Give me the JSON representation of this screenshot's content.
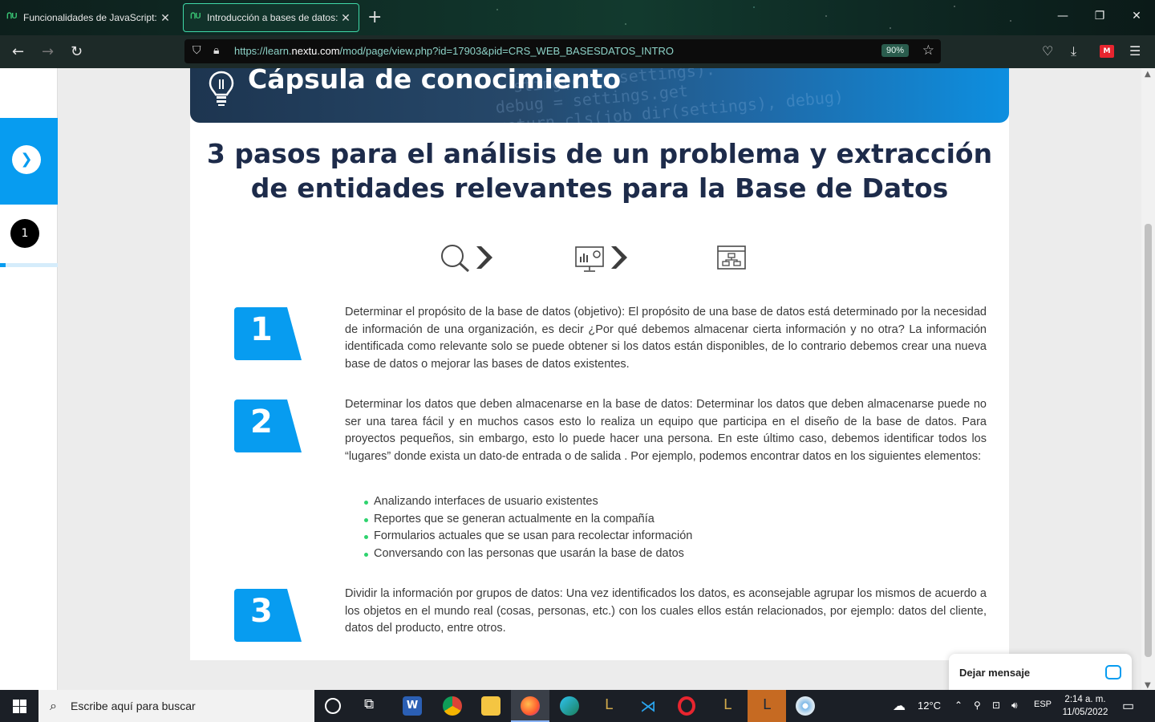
{
  "browser": {
    "tabs": [
      {
        "title": "Funcionalidades de JavaScript: F",
        "active": false
      },
      {
        "title": "Introducción a bases de datos: ",
        "active": true
      }
    ],
    "url_prefix": "https://learn.",
    "url_domain": "nextu.com",
    "url_rest": "/mod/page/view.php?id=17903&pid=CRS_WEB_BASESDATOS_INTRO",
    "zoom": "90%"
  },
  "page": {
    "banner_title": "Cápsula de conocimiento",
    "banner_code": "  sting(cls, settings).\ndebug = settings.get\nreturn cls(job_dir(settings), debug)",
    "heading_line1": "3 pasos para el análisis de un problema y extracción",
    "heading_line2": "de entidades relevantes para la Base de Datos",
    "rail_number": "1",
    "steps": [
      {
        "number": "1",
        "text": "Determinar el propósito de la base de datos (objetivo): El propósito de una base de datos está determinado por la necesidad de información de una organización, es decir ¿Por qué debemos almacenar cierta información y no otra? La información identificada como relevante solo se puede obtener si los datos están disponibles, de lo contrario debemos crear una nueva base de datos o mejorar las bases de datos existentes."
      },
      {
        "number": "2",
        "text": "Determinar los datos que deben almacenarse en la base de datos: Determinar los datos que deben almacenarse puede no ser una tarea fácil y en muchos casos esto lo realiza un equipo que participa en el diseño de la base de datos. Para proyectos pequeños, sin embargo, esto lo puede hacer una persona. En este último caso, debemos identificar todos los “lugares” donde exista un dato-de entrada o de salida . Por ejemplo, podemos encontrar datos en los siguientes elementos:"
      },
      {
        "number": "3",
        "text": "Dividir la información por grupos de datos: Una vez identificados los datos, es aconsejable agrupar los mismos de acuerdo a los objetos en el mundo real (cosas, personas, etc.) con los cuales ellos están relacionados, por ejemplo: datos del cliente, datos del producto, entre otros."
      }
    ],
    "bullets": [
      "Analizando interfaces de usuario existentes",
      "Reportes que se generan actualmente en la compañía",
      "Formularios actuales que se usan para recolectar información",
      "Conversando con las personas que usarán la base de datos"
    ],
    "chat_label": "Dejar mensaje"
  },
  "taskbar": {
    "search_placeholder": "Escribe aquí para buscar",
    "weather": "12°C",
    "language": "ESP",
    "time": "2:14 a. m.",
    "date": "11/05/2022"
  },
  "colors": {
    "accent": "#079cf0",
    "heading": "#1d2b4a",
    "bullet": "#2ed36e"
  }
}
